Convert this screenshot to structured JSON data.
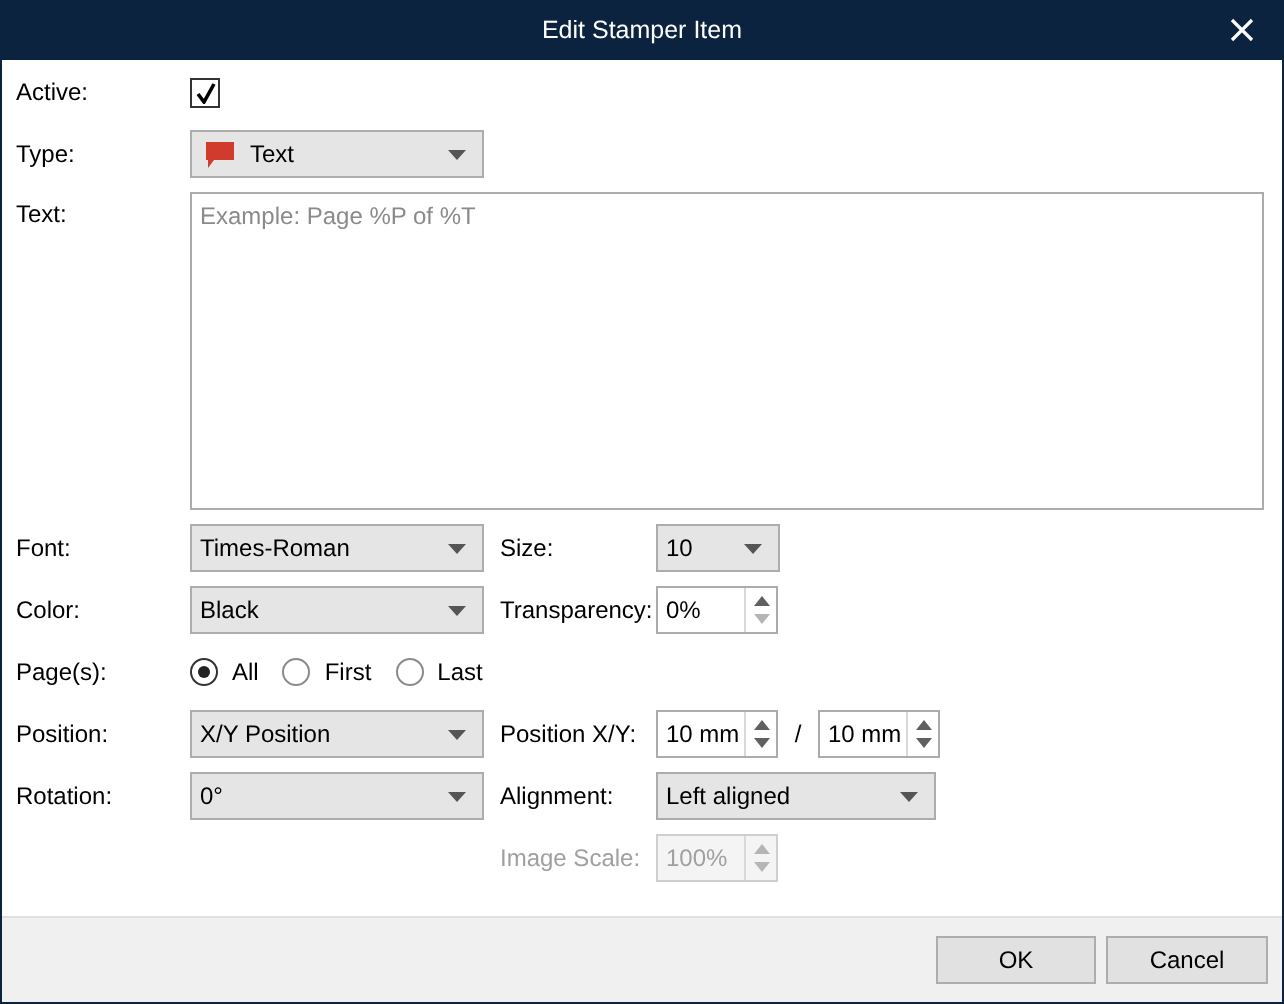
{
  "window": {
    "title": "Edit Stamper Item"
  },
  "active": {
    "label": "Active:",
    "checked": true
  },
  "type": {
    "label": "Type:",
    "value": "Text"
  },
  "text": {
    "label": "Text:",
    "placeholder": "Example: Page %P of %T"
  },
  "font": {
    "label": "Font:",
    "value": "Times-Roman"
  },
  "size": {
    "label": "Size:",
    "value": "10"
  },
  "color": {
    "label": "Color:",
    "value": "Black"
  },
  "transparency": {
    "label": "Transparency:",
    "value": "0%",
    "disabled": false,
    "down_disabled": true
  },
  "pages": {
    "label": "Page(s):",
    "options": [
      {
        "label": "All",
        "selected": true
      },
      {
        "label": "First",
        "selected": false
      },
      {
        "label": "Last",
        "selected": false
      }
    ]
  },
  "position": {
    "label": "Position:",
    "value": "X/Y Position"
  },
  "position_xy": {
    "label": "Position X/Y:",
    "separator": "/",
    "x": {
      "value": "10 mm",
      "disabled": false,
      "down_disabled": false
    },
    "y": {
      "value": "10 mm",
      "disabled": false,
      "down_disabled": false
    }
  },
  "rotation": {
    "label": "Rotation:",
    "value": "0°"
  },
  "alignment": {
    "label": "Alignment:",
    "value": "Left aligned"
  },
  "image_scale": {
    "label": "Image Scale:",
    "value": "100%",
    "disabled": true
  },
  "buttons": [
    {
      "label": "OK"
    },
    {
      "label": "Cancel"
    }
  ]
}
